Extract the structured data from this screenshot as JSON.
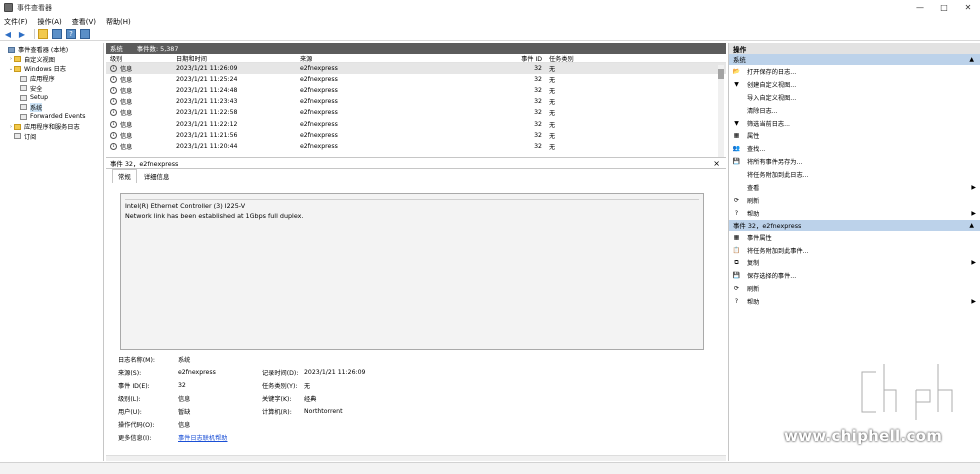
{
  "window": {
    "title": "事件查看器",
    "controls": {
      "minimize": "—",
      "maximize": "□",
      "close": "✕"
    }
  },
  "menu": [
    "文件(F)",
    "操作(A)",
    "查看(V)",
    "帮助(H)"
  ],
  "tree": [
    {
      "label": "事件查看器 (本地)",
      "level": 0,
      "twist": "",
      "icon": "comp"
    },
    {
      "label": "自定义视图",
      "level": 1,
      "twist": "›",
      "icon": "folder"
    },
    {
      "label": "Windows 日志",
      "level": 1,
      "twist": "⌄",
      "icon": "folder"
    },
    {
      "label": "应用程序",
      "level": 2,
      "twist": "",
      "icon": "log"
    },
    {
      "label": "安全",
      "level": 2,
      "twist": "",
      "icon": "log"
    },
    {
      "label": "Setup",
      "level": 2,
      "twist": "",
      "icon": "log"
    },
    {
      "label": "系统",
      "level": 2,
      "twist": "",
      "icon": "log",
      "selected": true
    },
    {
      "label": "Forwarded Events",
      "level": 2,
      "twist": "",
      "icon": "log"
    },
    {
      "label": "应用程序和服务日志",
      "level": 1,
      "twist": "›",
      "icon": "folder"
    },
    {
      "label": "订阅",
      "level": 1,
      "twist": "",
      "icon": "log"
    }
  ],
  "log": {
    "name": "系统",
    "count_label": "事件数: 5,387",
    "columns": {
      "level": "级别",
      "date": "日期和时间",
      "source": "来源",
      "id": "事件 ID",
      "task": "任务类别"
    },
    "rows": [
      {
        "level": "信息",
        "date": "2023/1/21 11:26:09",
        "source": "e2fnexpress",
        "id": "32",
        "task": "无",
        "selected": true
      },
      {
        "level": "信息",
        "date": "2023/1/21 11:25:24",
        "source": "e2fnexpress",
        "id": "32",
        "task": "无"
      },
      {
        "level": "信息",
        "date": "2023/1/21 11:24:48",
        "source": "e2fnexpress",
        "id": "32",
        "task": "无"
      },
      {
        "level": "信息",
        "date": "2023/1/21 11:23:43",
        "source": "e2fnexpress",
        "id": "32",
        "task": "无"
      },
      {
        "level": "信息",
        "date": "2023/1/21 11:22:58",
        "source": "e2fnexpress",
        "id": "32",
        "task": "无"
      },
      {
        "level": "信息",
        "date": "2023/1/21 11:22:12",
        "source": "e2fnexpress",
        "id": "32",
        "task": "无"
      },
      {
        "level": "信息",
        "date": "2023/1/21 11:21:56",
        "source": "e2fnexpress",
        "id": "32",
        "task": "无"
      },
      {
        "level": "信息",
        "date": "2023/1/21 11:20:44",
        "source": "e2fnexpress",
        "id": "32",
        "task": "无"
      }
    ]
  },
  "detail": {
    "header": "事件 32，e2fnexpress",
    "tabs": [
      "常规",
      "详细信息"
    ],
    "description": [
      "Intel(R) Ethernet Controller (3) I225-V",
      "Network link has been established at 1Gbps full duplex."
    ],
    "props": {
      "log_name_label": "日志名称(M):",
      "log_name": "系统",
      "source_label": "来源(S):",
      "source": "e2fnexpress",
      "logged_label": "记录时间(D):",
      "logged": "2023/1/21 11:26:09",
      "event_id_label": "事件 ID(E):",
      "event_id": "32",
      "task_label": "任务类别(Y):",
      "task": "无",
      "level_label": "级别(L):",
      "level": "信息",
      "keywords_label": "关键字(K):",
      "keywords": "经典",
      "user_label": "用户(U):",
      "user": "暂缺",
      "computer_label": "计算机(R):",
      "computer": "Northtorrent",
      "opcode_label": "操作代码(O):",
      "opcode": "信息",
      "more_label": "更多信息(I):",
      "more_link": "事件日志联机帮助"
    }
  },
  "actions": {
    "title": "操作",
    "section1": "系统",
    "items1": [
      {
        "label": "打开保存的日志...",
        "icon": "📂",
        "sub": ""
      },
      {
        "label": "创建自定义视图...",
        "icon": "▼",
        "sub": ""
      },
      {
        "label": "导入自定义视图...",
        "icon": "",
        "sub": ""
      },
      {
        "label": "清除日志...",
        "icon": "",
        "sub": ""
      },
      {
        "label": "筛选当前日志...",
        "icon": "▼",
        "sub": ""
      },
      {
        "label": "属性",
        "icon": "▦",
        "sub": ""
      },
      {
        "label": "查找...",
        "icon": "👥",
        "sub": ""
      },
      {
        "label": "将所有事件另存为...",
        "icon": "💾",
        "sub": ""
      },
      {
        "label": "将任务附加到此日志...",
        "icon": "",
        "sub": ""
      },
      {
        "label": "查看",
        "icon": "",
        "sub": "▶"
      },
      {
        "label": "刷新",
        "icon": "⟳",
        "sub": ""
      },
      {
        "label": "帮助",
        "icon": "?",
        "sub": "▶"
      }
    ],
    "section2": "事件 32，e2fnexpress",
    "items2": [
      {
        "label": "事件属性",
        "icon": "▦",
        "sub": ""
      },
      {
        "label": "将任务附加到此事件...",
        "icon": "📋",
        "sub": ""
      },
      {
        "label": "复制",
        "icon": "⧉",
        "sub": "▶"
      },
      {
        "label": "保存选择的事件...",
        "icon": "💾",
        "sub": ""
      },
      {
        "label": "刷新",
        "icon": "⟳",
        "sub": ""
      },
      {
        "label": "帮助",
        "icon": "?",
        "sub": "▶"
      }
    ]
  },
  "watermark": {
    "text": "www.chiphell.com"
  }
}
